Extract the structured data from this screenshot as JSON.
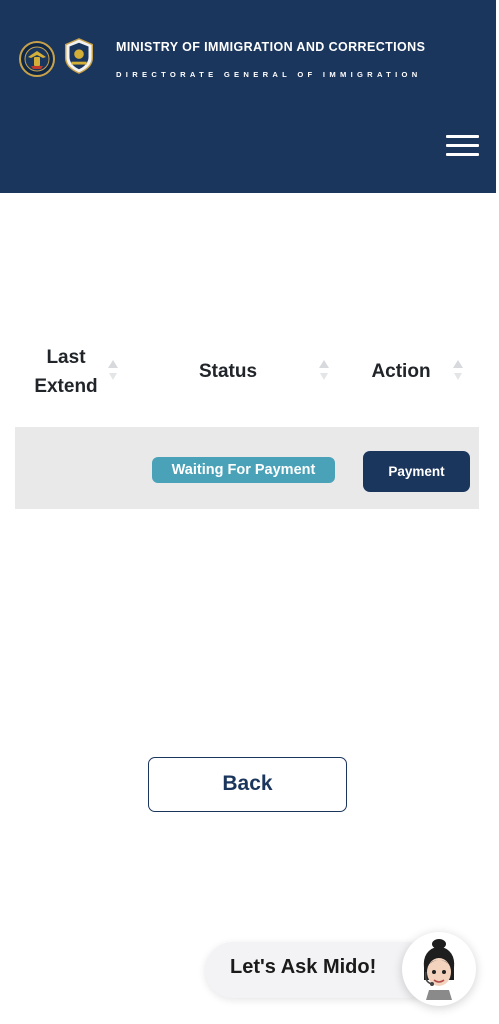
{
  "header": {
    "title": "MINISTRY OF IMMIGRATION AND CORRECTIONS",
    "subtitle": "DIRECTORATE GENERAL OF IMMIGRATION",
    "colors": {
      "background": "#1b365d",
      "text": "#ffffff"
    }
  },
  "table": {
    "columns": [
      {
        "label_line1": "Last",
        "label_line2": "Extend"
      },
      {
        "label": "Status"
      },
      {
        "label": "Action"
      }
    ],
    "rows": [
      {
        "last_extend": "",
        "status": "Waiting For Payment",
        "action": "Payment"
      }
    ],
    "colors": {
      "status_badge": "#4aa2b8",
      "row_bg": "#e9e9ea",
      "action_button": "#1b365d"
    }
  },
  "back_button": {
    "label": "Back"
  },
  "chat": {
    "label": "Let's Ask Mido!"
  },
  "icons": {
    "logo_left": "garuda-emblem-icon",
    "logo_right": "immigration-badge-icon",
    "menu": "hamburger-menu-icon",
    "sort": "sort-arrows-icon",
    "chat_avatar": "mido-avatar-icon"
  }
}
